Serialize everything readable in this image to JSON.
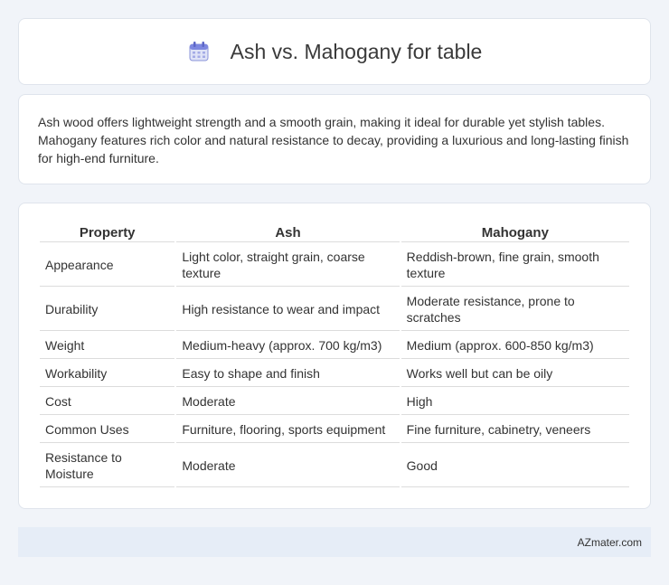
{
  "header": {
    "title": "Ash vs. Mahogany for table",
    "icon": "calendar-icon"
  },
  "intro": {
    "text": "Ash wood offers lightweight strength and a smooth grain, making it ideal for durable yet stylish tables. Mahogany features rich color and natural resistance to decay, providing a luxurious and long-lasting finish for high-end furniture."
  },
  "table": {
    "headers": [
      "Property",
      "Ash",
      "Mahogany"
    ],
    "rows": [
      [
        "Appearance",
        "Light color, straight grain, coarse texture",
        "Reddish-brown, fine grain, smooth texture"
      ],
      [
        "Durability",
        "High resistance to wear and impact",
        "Moderate resistance, prone to scratches"
      ],
      [
        "Weight",
        "Medium-heavy (approx. 700 kg/m3)",
        "Medium (approx. 600-850 kg/m3)"
      ],
      [
        "Workability",
        "Easy to shape and finish",
        "Works well but can be oily"
      ],
      [
        "Cost",
        "Moderate",
        "High"
      ],
      [
        "Common Uses",
        "Furniture, flooring, sports equipment",
        "Fine furniture, cabinetry, veneers"
      ],
      [
        "Resistance to Moisture",
        "Moderate",
        "Good"
      ]
    ]
  },
  "footer": {
    "text": "AZmater.com"
  },
  "colors": {
    "background": "#f1f4f9",
    "card": "#ffffff",
    "footer_bg": "#e6edf7"
  }
}
